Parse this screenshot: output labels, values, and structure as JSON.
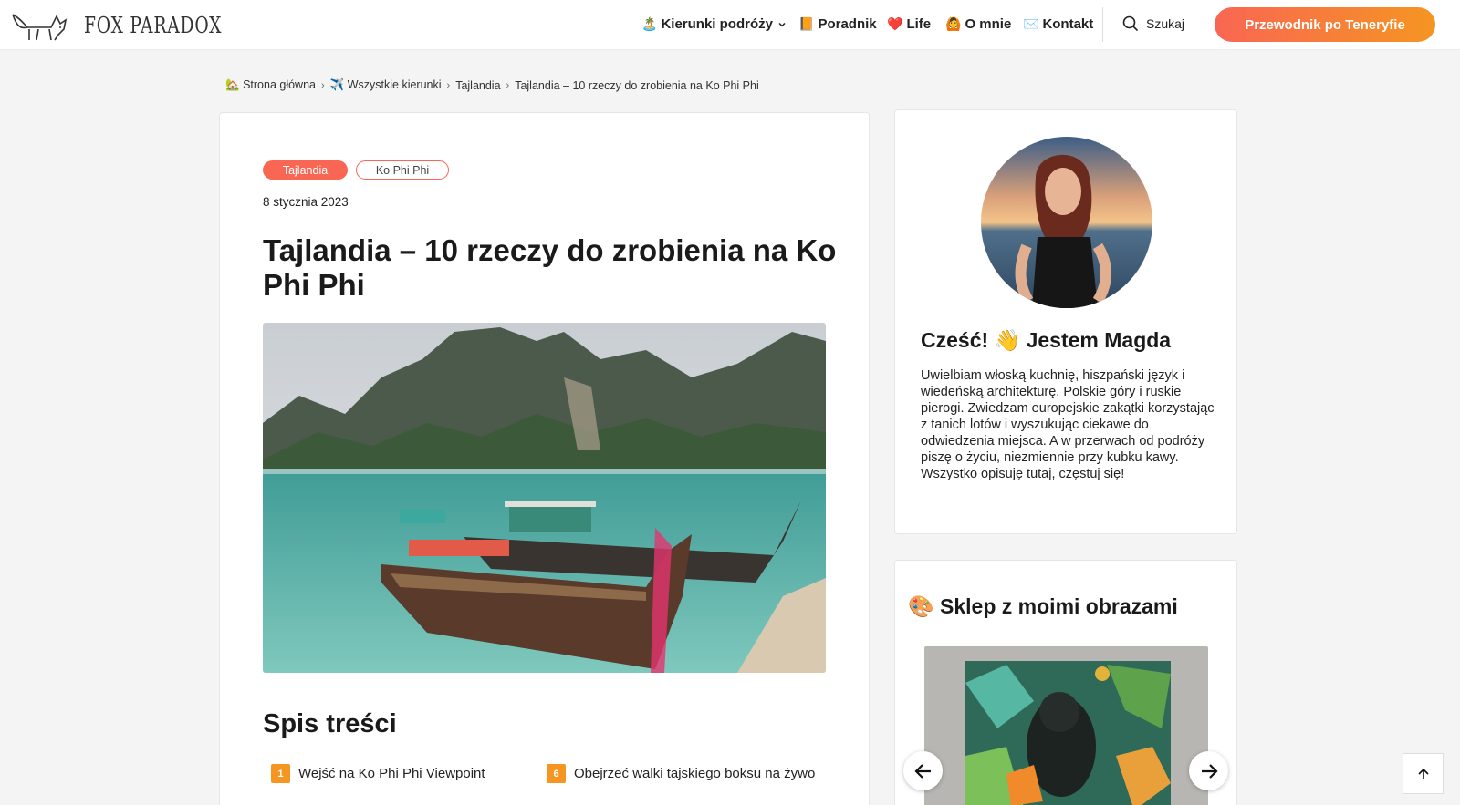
{
  "header": {
    "logo_text": "FOX PARADOX",
    "nav": [
      {
        "emoji": "🏝️",
        "label": "Kierunki podróży",
        "has_dropdown": true
      },
      {
        "emoji": "📙",
        "label": "Poradnik"
      },
      {
        "emoji": "❤️",
        "label": "Life"
      },
      {
        "emoji": "🙆",
        "label": "O mnie"
      },
      {
        "emoji": "✉️",
        "label": "Kontakt"
      }
    ],
    "search_label": "Szukaj",
    "cta_label": "Przewodnik po Teneryfie"
  },
  "breadcrumb": [
    {
      "emoji": "🏡",
      "label": "Strona główna"
    },
    {
      "emoji": "✈️",
      "label": "Wszystkie kierunki"
    },
    {
      "emoji": "",
      "label": "Tajlandia"
    },
    {
      "emoji": "",
      "label": "Tajlandia – 10 rzeczy do zrobienia na Ko Phi Phi"
    }
  ],
  "post": {
    "tags": [
      "Tajlandia",
      "Ko Phi Phi"
    ],
    "date": "8 stycznia 2023",
    "title": "Tajlandia – 10 rzeczy do zrobienia na Ko Phi Phi"
  },
  "toc": {
    "title": "Spis treści",
    "items": [
      {
        "num": "1",
        "label": "Wejść na Ko Phi Phi Viewpoint"
      },
      {
        "num": "6",
        "label": "Obejrzeć walki tajskiego boksu na żywo"
      }
    ]
  },
  "sidebar": {
    "about_title_before": "Cześć! ",
    "about_emoji": "👋",
    "about_title_after": " Jestem Magda",
    "about_text": "Uwielbiam włoską kuchnię, hiszpański język i wiedeńską architekturę. Polskie góry i ruskie pierogi. Zwiedzam europejskie zakątki korzystając z tanich lotów i wyszukując ciekawe do odwiedzenia miejsca. A w przerwach od podróży piszę o życiu, niezmiennie przy kubku kawy. Wszystko opisuję tutaj, częstuj się!",
    "shop_emoji": "🎨",
    "shop_title": "Sklep z moimi obrazami"
  },
  "colors": {
    "accent": "#f96653",
    "accent_orange": "#f59522",
    "background": "#f4f4f4"
  },
  "icons": {
    "logo": "fox-icon",
    "search": "search-icon",
    "dropdown": "chevron-down-icon",
    "prev": "arrow-left-icon",
    "next": "arrow-right-icon",
    "back_to_top": "arrow-up-icon"
  }
}
